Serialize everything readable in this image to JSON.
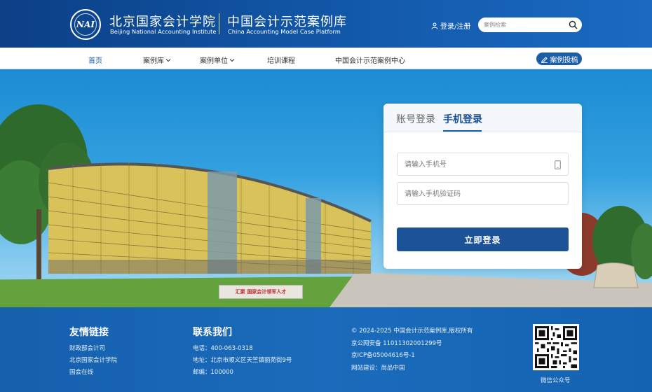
{
  "header": {
    "institute_cn": "北京国家会计学院",
    "institute_en": "Beijing National Accounting Institute",
    "platform_cn": "中国会计示范案例库",
    "platform_en": "China Accounting Model Case Platform",
    "login_register": "登录/注册",
    "search_placeholder": "案例检索"
  },
  "nav": {
    "items": [
      {
        "label": "首页",
        "active": true
      },
      {
        "label": "案例库",
        "has_dropdown": true
      },
      {
        "label": "案例单位",
        "has_dropdown": true
      },
      {
        "label": "培训课程"
      },
      {
        "label": "中国会计示范案例中心"
      }
    ],
    "submit_case": "案例投稿"
  },
  "hero": {
    "sign_text": "汇聚 国家会计领军人才"
  },
  "login": {
    "tabs": [
      {
        "label": "账号登录",
        "active": false
      },
      {
        "label": "手机登录",
        "active": true
      }
    ],
    "phone_placeholder": "请输入手机号",
    "code_placeholder": "请输入手机验证码",
    "submit_label": "立即登录"
  },
  "footer": {
    "links_title": "友情链接",
    "links": [
      "财政部会计司",
      "北京国家会计学院",
      "国会在线"
    ],
    "contact_title": "联系我们",
    "contact": {
      "phone": "电话：400-063-0318",
      "address": "地址：北京市顺义区天竺镇丽苑街9号",
      "postcode": "邮编：100000"
    },
    "info": {
      "copyright": "© 2024-2025 中国会计示范案例库,版权所有",
      "police": "京公网安备 11011302001299号",
      "icp": "京ICP备05004616号-1",
      "builder": "网站建设：尚品中国"
    },
    "qr_label": "微信公众号"
  },
  "colors": {
    "header_blue": "#1155a4",
    "accent_blue": "#1b5ea6",
    "login_button": "#1b5396",
    "footer_blue": "#1a6bbb"
  },
  "icons": {
    "user": "user-icon",
    "search": "search-icon",
    "chevron": "chevron-down-icon",
    "submit": "edit-icon",
    "mobile": "mobile-phone-icon",
    "qr": "qr-code-icon"
  }
}
